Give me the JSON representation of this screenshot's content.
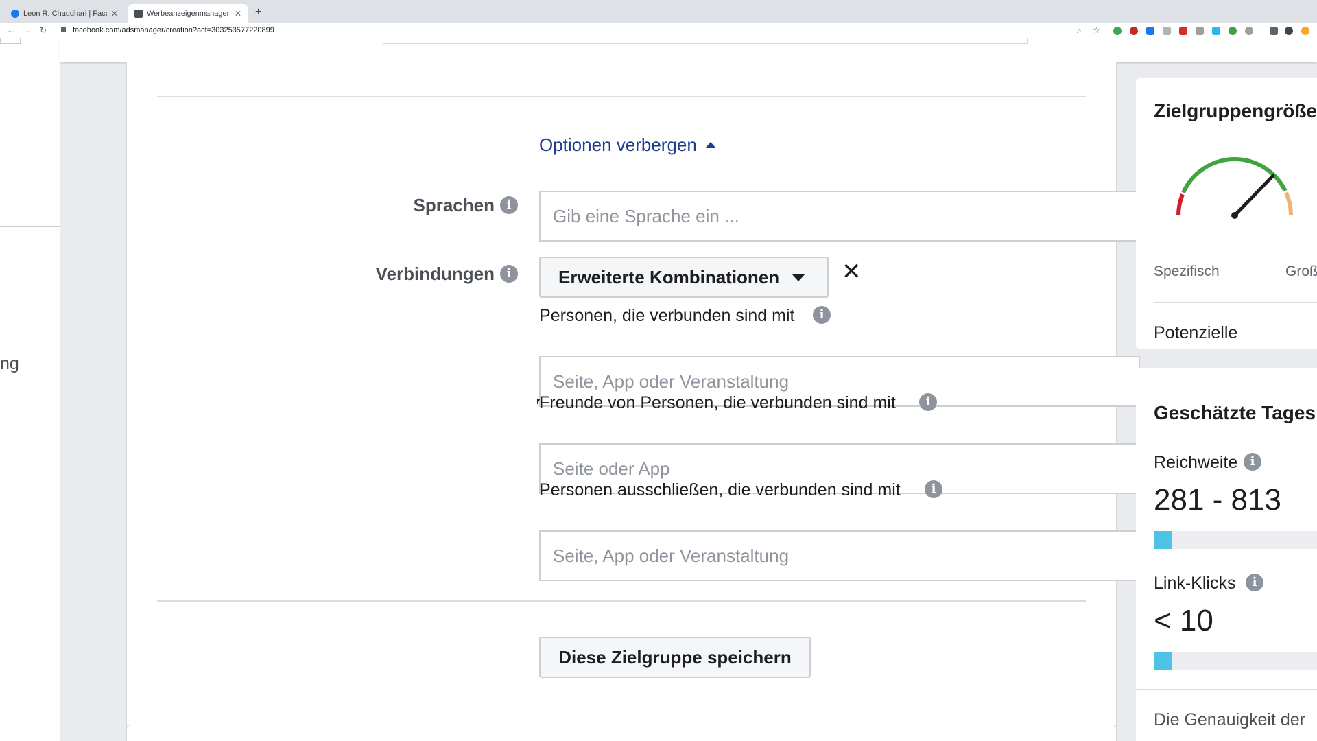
{
  "browser": {
    "tabs": [
      {
        "title": "Leon R. Chaudhari | Facebook",
        "active": false
      },
      {
        "title": "Werbeanzeigenmanager - Cre",
        "active": true
      }
    ],
    "url": "facebook.com/adsmanager/creation?act=303253577220899"
  },
  "sidebar": {
    "fragment": "ng"
  },
  "form": {
    "toggle_label": "Optionen verbergen",
    "languages": {
      "label": "Sprachen",
      "placeholder": "Gib eine Sprache ein ..."
    },
    "connections": {
      "label": "Verbindungen",
      "dropdown_label": "Erweiterte Kombinationen",
      "groups": [
        {
          "label": "Personen, die verbunden sind mit",
          "placeholder": "Seite, App oder Veranstaltung"
        },
        {
          "label": "Freunde von Personen, die verbunden sind mit",
          "placeholder": "Seite oder App"
        },
        {
          "label": "Personen ausschließen, die verbunden sind mit",
          "placeholder": "Seite, App oder Veranstaltung"
        }
      ]
    },
    "save_button": "Diese Zielgruppe speichern"
  },
  "audience_size": {
    "title": "Zielgruppengröße",
    "left_label": "Spezifisch",
    "right_label": "Groß",
    "potential_reach_label": "Potenzielle Reichweite:",
    "colors": {
      "red": "#d0202f",
      "green": "#42a33f",
      "orange": "#f0b27a"
    }
  },
  "daily_results": {
    "title": "Geschätzte Tages",
    "reach_label": "Reichweite",
    "reach_value": "281 - 813",
    "reach_fill_fraction": 0.1,
    "clicks_label": "Link-Klicks",
    "clicks_value": "< 10",
    "clicks_fill_fraction": 0.1,
    "bar_color": "#4dc3e6"
  },
  "disclaimer": {
    "line1": "Die Genauigkeit der"
  }
}
